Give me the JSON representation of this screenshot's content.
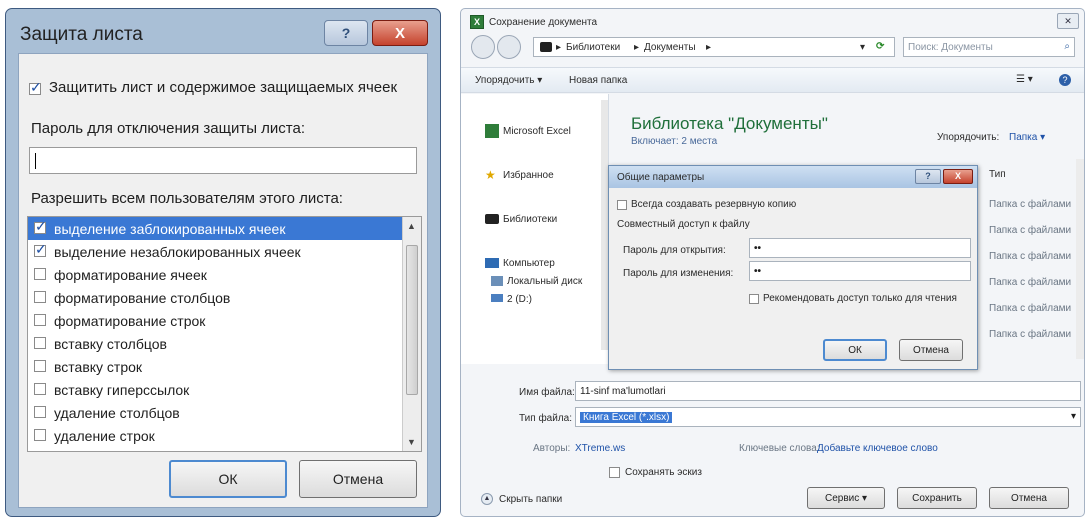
{
  "protect_dialog": {
    "title": "Защита листа",
    "help_btn": "?",
    "close_btn": "X",
    "protect_checkbox_label": "Защитить лист и содержимое защищаемых ячеек",
    "password_label": "Пароль для отключения защиты листа:",
    "password_value": "",
    "allow_label": "Разрешить всем пользователям этого листа:",
    "permissions": [
      {
        "label": "выделение заблокированных ячеек",
        "checked": true,
        "selected": true
      },
      {
        "label": "выделение незаблокированных ячеек",
        "checked": true,
        "selected": false
      },
      {
        "label": "форматирование ячеек",
        "checked": false,
        "selected": false
      },
      {
        "label": "форматирование столбцов",
        "checked": false,
        "selected": false
      },
      {
        "label": "форматирование строк",
        "checked": false,
        "selected": false
      },
      {
        "label": "вставку столбцов",
        "checked": false,
        "selected": false
      },
      {
        "label": "вставку строк",
        "checked": false,
        "selected": false
      },
      {
        "label": "вставку гиперссылок",
        "checked": false,
        "selected": false
      },
      {
        "label": "удаление столбцов",
        "checked": false,
        "selected": false
      },
      {
        "label": "удаление строк",
        "checked": false,
        "selected": false
      }
    ],
    "ok_btn": "ОК",
    "cancel_btn": "Отмена"
  },
  "save_dialog": {
    "title": "Сохранение документа",
    "breadcrumb": [
      "Библиотеки",
      "Документы"
    ],
    "search_placeholder": "Поиск: Документы",
    "toolbar": {
      "organize": "Упорядочить ▾",
      "new_folder": "Новая папка"
    },
    "nav": {
      "excel": "Microsoft Excel",
      "favorites": "Избранное",
      "libraries": "Библиотеки",
      "computer": "Компьютер",
      "local_disk": "Локальный диск",
      "disk2": "2 (D:)"
    },
    "library_title": "Библиотека \"Документы\"",
    "library_sub": "Включает: 2 места",
    "arrange_label": "Упорядочить:",
    "arrange_value": "Папка ▾",
    "col_type": "Тип",
    "type_items": [
      "Папка с файлами",
      "Папка с файлами",
      "Папка с файлами",
      "Папка с файлами",
      "Папка с файлами",
      "Папка с файлами"
    ],
    "filename_label": "Имя файла:",
    "filename_value": "11-sinf ma'lumotlari",
    "filetype_label": "Тип файла:",
    "filetype_value": "Книга Excel (*.xlsx)",
    "authors_label": "Авторы:",
    "authors_value": "XTreme.ws",
    "keywords_label": "Ключевые слова:",
    "keywords_value": "Добавьте ключевое слово",
    "thumbnail_label": "Сохранять эскиз",
    "hide_folders": "Скрыть папки",
    "service_btn": "Сервис",
    "save_btn": "Сохранить",
    "cancel_btn": "Отмена"
  },
  "general_params": {
    "title": "Общие параметры",
    "backup_label": "Всегда создавать резервную копию",
    "sharing_label": "Совместный доступ к файлу",
    "open_pwd_label": "Пароль для открытия:",
    "open_pwd_value": "••",
    "modify_pwd_label": "Пароль для изменения:",
    "modify_pwd_value": "••",
    "readonly_label": "Рекомендовать доступ только для чтения",
    "ok_btn": "ОК",
    "cancel_btn": "Отмена"
  }
}
